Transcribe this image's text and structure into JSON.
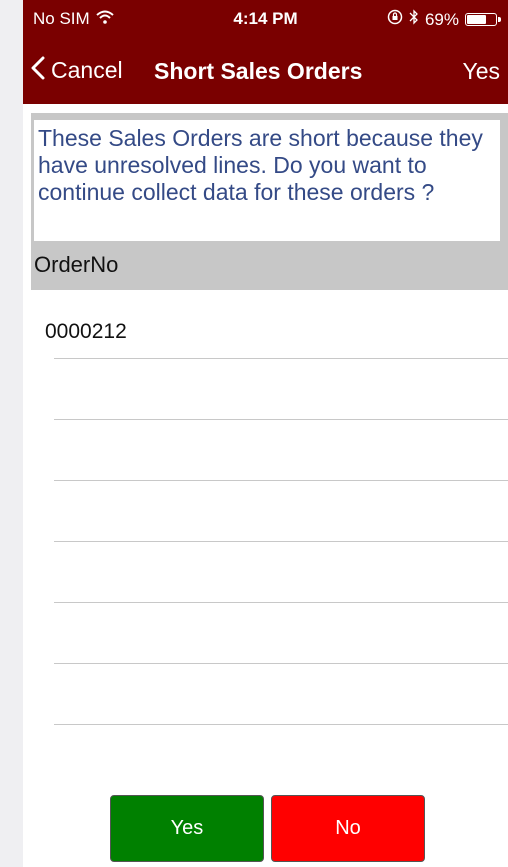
{
  "status_bar": {
    "carrier": "No SIM",
    "time": "4:14 PM",
    "battery_percent": "69%",
    "battery_level": 0.69
  },
  "nav": {
    "back_label": "Cancel",
    "title": "Short Sales Orders",
    "action_label": "Yes"
  },
  "message": {
    "text": "These Sales Orders are short because they have unresolved lines. Do you want to continue collect data for these orders ?"
  },
  "table": {
    "column_header": "OrderNo",
    "rows": [
      "0000212",
      "",
      "",
      "",
      "",
      "",
      ""
    ]
  },
  "buttons": {
    "yes_label": "Yes",
    "no_label": "No"
  },
  "colors": {
    "header_bg": "#7a0000",
    "message_text": "#344a86",
    "yes_button": "#008000",
    "no_button": "#ff0000"
  },
  "icons": {
    "wifi": "wifi-icon",
    "orientation_lock": "orientation-lock-icon",
    "bluetooth": "bluetooth-icon",
    "battery": "battery-icon",
    "back": "chevron-left-icon"
  }
}
